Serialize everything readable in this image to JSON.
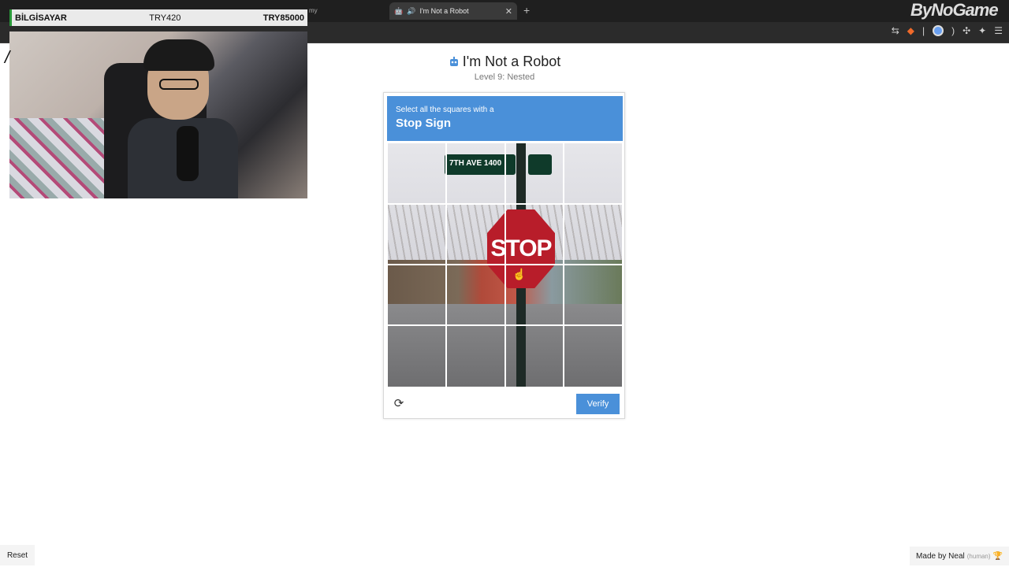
{
  "browser": {
    "active_tab_title": "I'm Not a Robot",
    "other_tab_fragment": "my",
    "brand_logo": "ByNoGame"
  },
  "overlay": {
    "streamer_label": "BİLGİSAYAR",
    "amount_1": "TRY420",
    "amount_2": "TRY85000"
  },
  "left_clip_text": "/",
  "page": {
    "title": "I'm Not a Robot",
    "subtitle": "Level 9: Nested"
  },
  "captcha": {
    "prompt_line": "Select all the squares with a",
    "prompt_target": "Stop Sign",
    "verify_label": "Verify",
    "street_sign_text": "7TH  AVE 1400",
    "stop_sign_text": "STOP",
    "accent_color": "#4a90d9"
  },
  "footer": {
    "reset_label": "Reset",
    "made_by": "Made by Neal",
    "made_by_note": "(human)"
  }
}
